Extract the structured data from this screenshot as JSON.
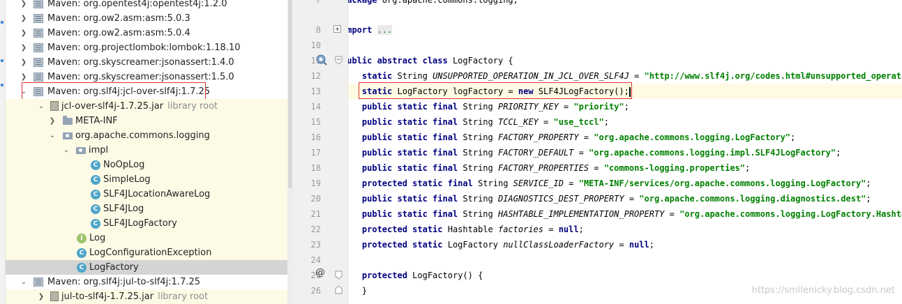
{
  "project_tree": {
    "rows": [
      {
        "label": "Maven: org.opentest4j:opentest4j:1.2.0",
        "suffix": "",
        "icon": "maven-library-icon",
        "arrow": "right"
      },
      {
        "label": "Maven: org.ow2.asm:asm:5.0.3",
        "suffix": "",
        "icon": "maven-library-icon",
        "arrow": "right"
      },
      {
        "label": "Maven: org.ow2.asm:asm:5.0.4",
        "suffix": "",
        "icon": "maven-library-icon",
        "arrow": "right"
      },
      {
        "label": "Maven: org.projectlombok:lombok:1.18.10",
        "suffix": "",
        "icon": "maven-library-icon",
        "arrow": "right"
      },
      {
        "label": "Maven: org.skyscreamer:jsonassert:1.4.0",
        "suffix": "",
        "icon": "maven-library-icon",
        "arrow": "right"
      },
      {
        "label": "Maven: org.skyscreamer:jsonassert:1.5.0",
        "suffix": "",
        "icon": "maven-library-icon",
        "arrow": "right"
      },
      {
        "label": "Maven: org.slf4j:jcl-over-slf4j:1.7.25",
        "suffix": "",
        "icon": "maven-library-icon",
        "arrow": "down"
      },
      {
        "label": "jcl-over-slf4j-1.7.25.jar",
        "suffix": "library root",
        "icon": "jar-icon",
        "arrow": "down"
      },
      {
        "label": "META-INF",
        "suffix": "",
        "icon": "folder-icon",
        "arrow": "right"
      },
      {
        "label": "org.apache.commons.logging",
        "suffix": "",
        "icon": "package-icon",
        "arrow": "down"
      },
      {
        "label": "impl",
        "suffix": "",
        "icon": "package-icon",
        "arrow": "down"
      },
      {
        "label": "NoOpLog",
        "suffix": "",
        "icon": "class-icon",
        "arrow": ""
      },
      {
        "label": "SimpleLog",
        "suffix": "",
        "icon": "class-icon",
        "arrow": ""
      },
      {
        "label": "SLF4JLocationAwareLog",
        "suffix": "",
        "icon": "class-icon",
        "arrow": ""
      },
      {
        "label": "SLF4JLog",
        "suffix": "",
        "icon": "class-icon",
        "arrow": ""
      },
      {
        "label": "SLF4JLogFactory",
        "suffix": "",
        "icon": "class-icon",
        "arrow": ""
      },
      {
        "label": "Log",
        "suffix": "",
        "icon": "interface-icon",
        "arrow": ""
      },
      {
        "label": "LogConfigurationException",
        "suffix": "",
        "icon": "class-icon",
        "arrow": ""
      },
      {
        "label": "LogFactory",
        "suffix": "",
        "icon": "class-icon",
        "arrow": ""
      },
      {
        "label": "Maven: org.slf4j:jul-to-slf4j:1.7.25",
        "suffix": "",
        "icon": "maven-library-icon",
        "arrow": "down"
      },
      {
        "label": "jul-to-slf4j-1.7.25.jar",
        "suffix": "library root",
        "icon": "jar-icon",
        "arrow": "right"
      }
    ],
    "class_icon_letter": "C",
    "interface_icon_letter": "I"
  },
  "editor": {
    "line_numbers": [
      "7",
      "8",
      "10",
      "11",
      "12",
      "13",
      "14",
      "15",
      "16",
      "17",
      "18",
      "19",
      "20",
      "21",
      "22",
      "23",
      "24",
      "25",
      "26"
    ],
    "current_line": "13",
    "highlight_color": "#e0312b",
    "gutter_markers": {
      "override_icon": "implements-marker-icon",
      "override_glyph": "@",
      "bulb_icon": "intention-bulb-icon"
    }
  },
  "watermark": "https://smilenicky.blog.csdn.net"
}
